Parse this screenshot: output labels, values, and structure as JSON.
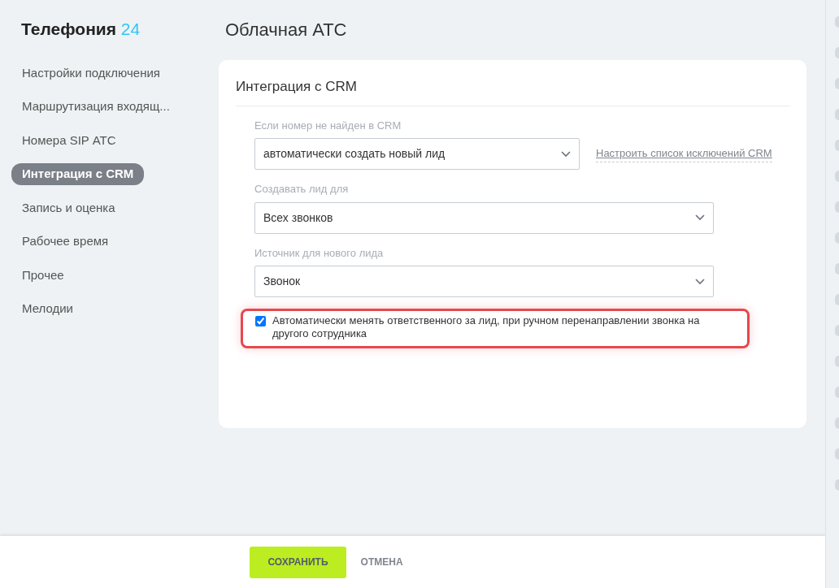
{
  "sidebar": {
    "brand": "Телефония",
    "brand_number": "24",
    "items": [
      {
        "label": "Настройки подключения",
        "selected": false
      },
      {
        "label": "Маршрутизация входящ...",
        "selected": false
      },
      {
        "label": "Номера SIP АТС",
        "selected": false
      },
      {
        "label": "Интеграция с CRM",
        "selected": true
      },
      {
        "label": "Запись и оценка",
        "selected": false
      },
      {
        "label": "Рабочее время",
        "selected": false
      },
      {
        "label": "Прочее",
        "selected": false
      },
      {
        "label": "Мелодии",
        "selected": false
      }
    ]
  },
  "page_title": "Облачная АТС",
  "card": {
    "title": "Интеграция с CRM",
    "fields": [
      {
        "label": "Если номер не найден в CRM",
        "value": "автоматически создать новый лид",
        "link": "Настроить список исключений CRM"
      },
      {
        "label": "Создавать лид для",
        "value": "Всех звонков"
      },
      {
        "label": "Источник для нового лида",
        "value": "Звонок"
      }
    ],
    "checkbox": {
      "label": "Автоматически менять ответственного за лид, при ручном перенаправлении звонка на другого сотрудника",
      "checked": true,
      "highlighted": true
    }
  },
  "buttons": [
    {
      "label": "СОХРАНИТЬ",
      "kind": "primary"
    },
    {
      "label": "ОТМЕНА",
      "kind": "link"
    }
  ]
}
